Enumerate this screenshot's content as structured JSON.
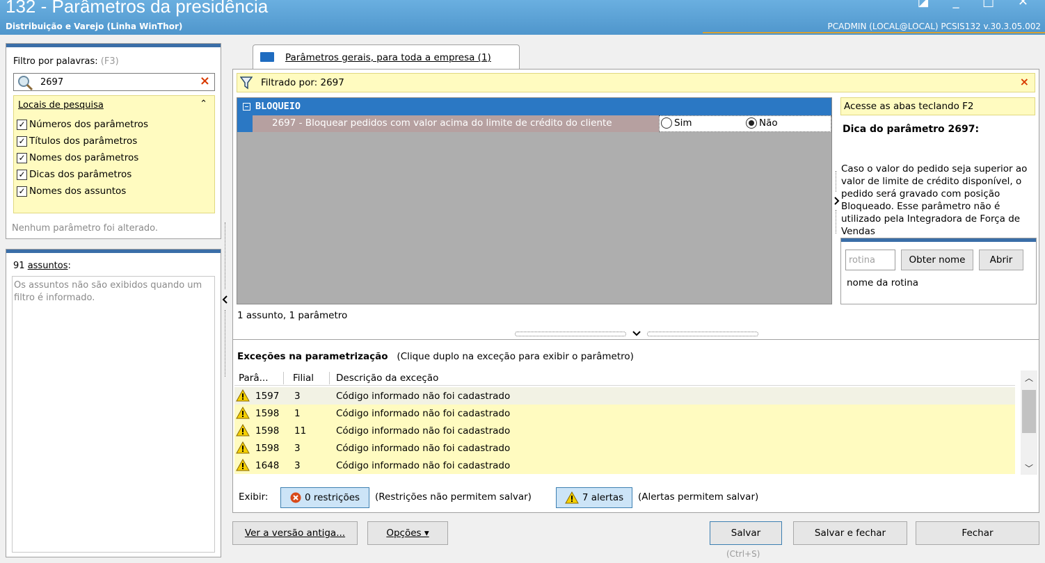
{
  "window": {
    "title": "132 - Parâmetros da presidência",
    "subtitle": "Distribuição e Varejo (Linha WinThor)",
    "user_info": "PCADMIN (LOCAL@LOCAL)   PCSIS132  v.30.3.05.002",
    "controls": "◪ _ □ ✕"
  },
  "filter": {
    "label": "Filtro por palavras: ",
    "shortcut": "(F3)",
    "value": "2697",
    "clear": "×",
    "places_title": "Locais de pesquisa",
    "collapse": "⌃",
    "options": [
      {
        "label": "Números dos parâmetros",
        "checked": true
      },
      {
        "label": "Títulos dos parâmetros",
        "checked": true
      },
      {
        "label": "Nomes dos parâmetros",
        "checked": true
      },
      {
        "label": "Dicas dos parâmetros",
        "checked": true
      },
      {
        "label": "Nomes dos assuntos",
        "checked": true
      }
    ],
    "check_mark": "✓",
    "no_change": "Nenhum parâmetro foi alterado."
  },
  "subjects": {
    "count_prefix": "91 ",
    "count_word": "assuntos",
    "count_suffix": ":",
    "message": "Os assuntos não são exibidos quando um filtro é informado."
  },
  "tab": {
    "label": "Parâmetros gerais, para toda a empresa  (1)"
  },
  "filter_bar": {
    "text": "Filtrado por: 2697",
    "clear": "×"
  },
  "grid": {
    "group": "BLOQUEIO",
    "param_title": "2697 - Bloquear pedidos com valor acima do limite de crédito do cliente",
    "option_yes": "Sim",
    "option_no": "Não",
    "selected": "Não",
    "status": "1 assunto, 1 parâmetro"
  },
  "tips": {
    "f2": "Acesse as abas teclando F2",
    "title": "Dica do parâmetro 2697:",
    "body": "Caso o valor do pedido seja superior ao valor de limite de crédito disponível, o pedido será gravado com posição Bloqueado. Esse parâmetro não é utilizado pela Integradora de Força de Vendas"
  },
  "routine": {
    "placeholder": "rotina",
    "get_name": "Obter nome",
    "open": "Abrir",
    "name": "nome da rotina"
  },
  "exceptions": {
    "title": "Exceções na parametrização",
    "hint": "(Clique duplo na exceção para exibir o parâmetro)",
    "columns": [
      "Parâ...",
      "Filial",
      "Descrição da exceção"
    ],
    "rows": [
      {
        "param": "1597",
        "branch": "3",
        "desc": "Código informado não foi cadastrado"
      },
      {
        "param": "1598",
        "branch": "1",
        "desc": "Código informado não foi cadastrado"
      },
      {
        "param": "1598",
        "branch": "11",
        "desc": "Código informado não foi cadastrado"
      },
      {
        "param": "1598",
        "branch": "3",
        "desc": "Código informado não foi cadastrado"
      },
      {
        "param": "1648",
        "branch": "3",
        "desc": "Código informado não foi cadastrado"
      }
    ],
    "show_label": "Exibir:",
    "restrictions_btn": "0 restrições",
    "restrictions_note": "(Restrições não permitem salvar)",
    "alerts_btn": "7 alertas",
    "alerts_note": "(Alertas permitem salvar)"
  },
  "buttons": {
    "old_version": "Ver a versão antiga...",
    "options": "Opções ▾",
    "save": "Salvar",
    "save_hint": "(Ctrl+S)",
    "save_close": "Salvar e fechar",
    "close": "Fechar"
  },
  "colors": {
    "accent": "#2b78c4",
    "highlight_yellow": "#fffbc0",
    "error": "#d83a00"
  }
}
